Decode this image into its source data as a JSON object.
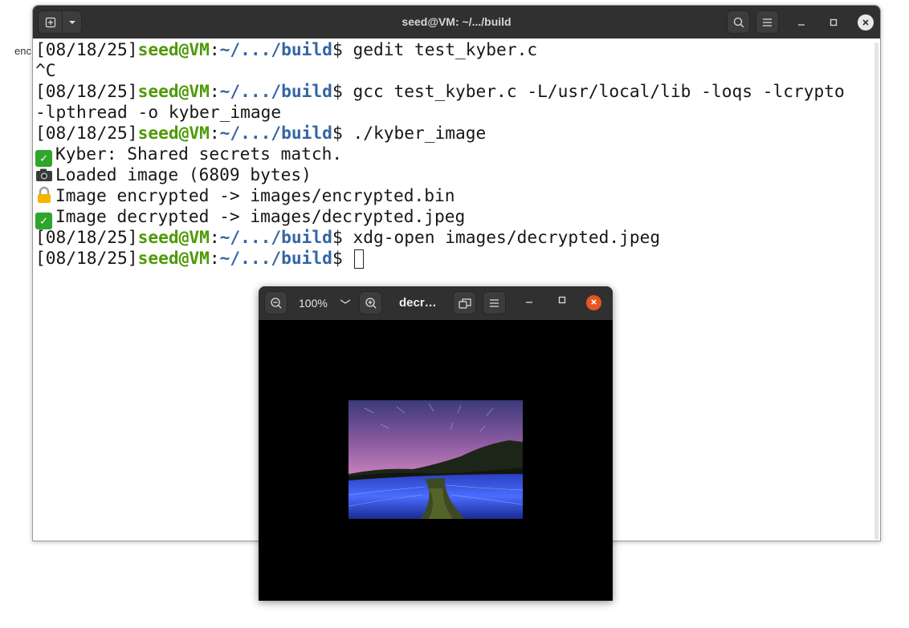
{
  "desktop": {
    "stray_text": "enc"
  },
  "terminal": {
    "title": "seed@VM: ~/.../build",
    "lines": [
      {
        "date": "[08/18/25]",
        "user": "seed@VM",
        "colon": ":",
        "path": "~/.../build",
        "dollar": "$",
        "cmd": " gedit test_kyber.c"
      },
      {
        "text": "^C"
      },
      {
        "date": "[08/18/25]",
        "user": "seed@VM",
        "colon": ":",
        "path": "~/.../build",
        "dollar": "$",
        "cmd": " gcc test_kyber.c -L/usr/local/lib -loqs -lcrypto"
      },
      {
        "text": "-lpthread -o kyber_image"
      },
      {
        "date": "[08/18/25]",
        "user": "seed@VM",
        "colon": ":",
        "path": "~/.../build",
        "dollar": "$",
        "cmd": " ./kyber_image"
      },
      {
        "icon": "check-mark-icon",
        "text": "Kyber: Shared secrets match."
      },
      {
        "icon": "camera-icon",
        "text": "Loaded image (6809 bytes)"
      },
      {
        "icon": "lock-icon",
        "text": "Image encrypted -> images/encrypted.bin"
      },
      {
        "icon": "check-mark-icon",
        "text": "Image decrypted -> images/decrypted.jpeg"
      },
      {
        "date": "[08/18/25]",
        "user": "seed@VM",
        "colon": ":",
        "path": "~/.../build",
        "dollar": "$",
        "cmd": " xdg-open images/decrypted.jpeg"
      },
      {
        "date": "[08/18/25]",
        "user": "seed@VM",
        "colon": ":",
        "path": "~/.../build",
        "dollar": "$",
        "cmd": " "
      }
    ],
    "colors": {
      "prompt_user": "#4e9a06",
      "prompt_path": "#3465a4",
      "header": "#303030"
    }
  },
  "viewer": {
    "zoom": "100%",
    "title": "decr…",
    "colors": {
      "close": "#e95420",
      "background": "#000000"
    }
  }
}
